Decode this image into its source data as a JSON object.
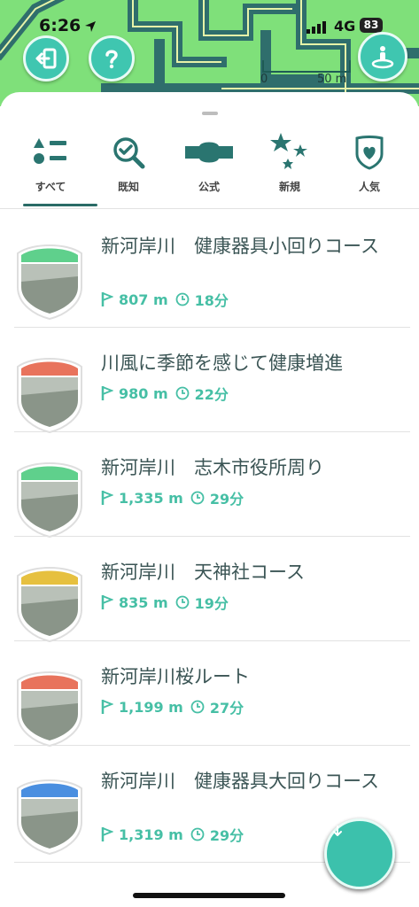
{
  "status_bar": {
    "time": "6:26",
    "network": "4G",
    "battery": "83"
  },
  "map": {
    "scale_zero": "0",
    "scale_label": "50 m"
  },
  "tabs": [
    {
      "label": "すべて",
      "icon": "shapes-list-icon",
      "selected": true
    },
    {
      "label": "既知",
      "icon": "magnifier-check-icon",
      "selected": false
    },
    {
      "label": "公式",
      "icon": "official-banner-icon",
      "selected": false
    },
    {
      "label": "新規",
      "icon": "stars-icon",
      "selected": false
    },
    {
      "label": "人気",
      "icon": "heart-shield-icon",
      "selected": false
    }
  ],
  "routes": [
    {
      "title": "新河岸川　健康器具小回りコース",
      "distance": "807 m",
      "duration": "18分",
      "badge_color": "#5fd08c"
    },
    {
      "title": "川風に季節を感じて健康増進",
      "distance": "980 m",
      "duration": "22分",
      "badge_color": "#e8735c"
    },
    {
      "title": "新河岸川　志木市役所周り",
      "distance": "1,335 m",
      "duration": "29分",
      "badge_color": "#5fd08c"
    },
    {
      "title": "新河岸川　天神社コース",
      "distance": "835 m",
      "duration": "19分",
      "badge_color": "#e6c03f"
    },
    {
      "title": "新河岸川桜ルート",
      "distance": "1,199 m",
      "duration": "27分",
      "badge_color": "#e8735c"
    },
    {
      "title": "新河岸川　健康器具大回りコース",
      "distance": "1,319 m",
      "duration": "29分",
      "badge_color": "#4a8fe0"
    }
  ],
  "colors": {
    "accent": "#46bfa5",
    "text": "#3b5555",
    "tab_icon": "#2a7570"
  }
}
